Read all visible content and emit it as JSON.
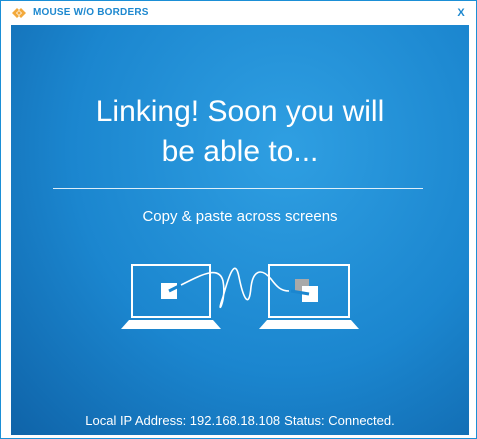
{
  "window": {
    "title": "MOUSE W/O BORDERS",
    "close_label": "X",
    "icon": "mouse-without-borders-logo-icon"
  },
  "main": {
    "headline_line1": "Linking! Soon you will",
    "headline_line2": "be able to...",
    "feature": "Copy & paste across screens",
    "illustration": "two-laptops-connected-icon"
  },
  "status": {
    "ip_label": "Local IP Address: 192.168.18.108",
    "state_label": "Status: Connected."
  },
  "colors": {
    "accent": "#1d88cf",
    "background_start": "#2f9fe2",
    "background_end": "#0f63a8",
    "text": "#ffffff"
  }
}
